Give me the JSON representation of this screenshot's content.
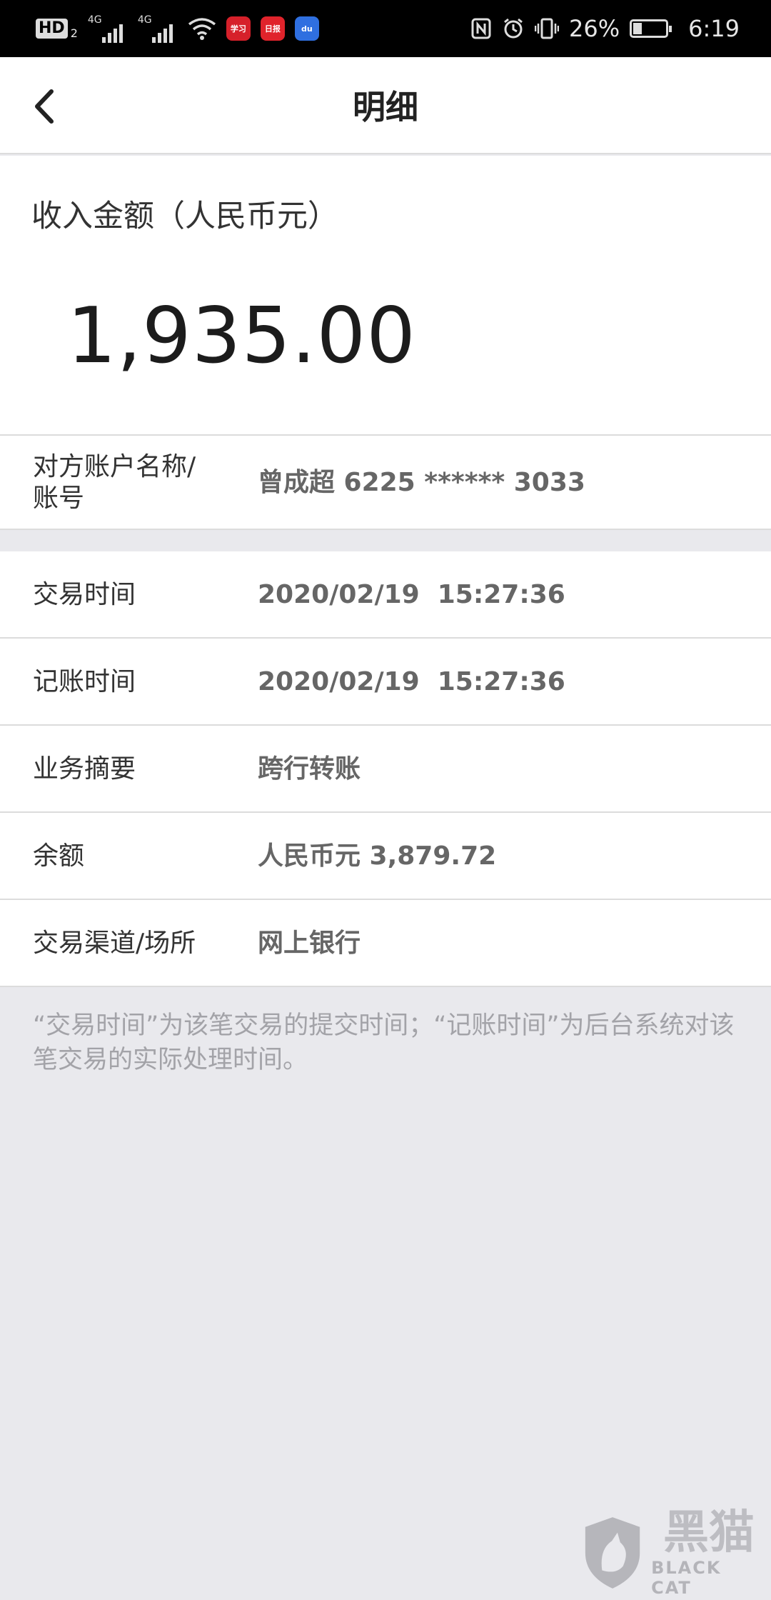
{
  "status_bar": {
    "hd": "HD",
    "hd_sub": "2",
    "sim1_network": "4G",
    "sim2_network": "4G",
    "app_icons": [
      {
        "name": "study-app-icon",
        "color": "#d6202a",
        "label": "学习"
      },
      {
        "name": "news-app-icon",
        "color": "#e0232b",
        "label": "日报"
      },
      {
        "name": "baidu-app-icon",
        "color": "#2f6fe0",
        "label": "du"
      }
    ],
    "battery": "26%",
    "time": "6:19"
  },
  "header": {
    "title": "明细"
  },
  "amount": {
    "label": "收入金额（人民币元）",
    "value": "1,935.00"
  },
  "details": [
    {
      "label": "对方账户名称/\n账号",
      "value": "曾成超 6225 ****** 3033"
    },
    {
      "label": "交易时间",
      "value": "2020/02/19  15:27:36"
    },
    {
      "label": "记账时间",
      "value": "2020/02/19  15:27:36"
    },
    {
      "label": "业务摘要",
      "value": "跨行转账"
    },
    {
      "label": "余额",
      "value": "人民币元 3,879.72"
    },
    {
      "label": "交易渠道/场所",
      "value": "网上银行"
    }
  ],
  "footnote": "“交易时间”为该笔交易的提交时间；“记账时间”为后台系统对该笔交易的实际处理时间。",
  "watermark": {
    "cn": "黑猫",
    "en": "BLACK CAT"
  },
  "colors": {
    "background": "#e9e9ed",
    "card": "#ffffff",
    "label_text": "#333333",
    "value_text": "#666666",
    "footnote_text": "#a3a3a8"
  }
}
